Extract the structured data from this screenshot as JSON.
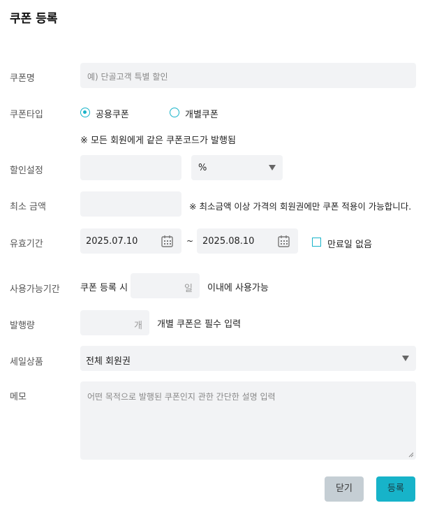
{
  "title": "쿠폰 등록",
  "labels": {
    "name": "쿠폰명",
    "type": "쿠폰타입",
    "discount": "할인설정",
    "min_amount": "최소 금액",
    "validity": "유효기간",
    "usable": "사용가능기간",
    "issue_qty": "발행량",
    "sale_item": "세일상품",
    "memo": "메모"
  },
  "coupon_name": {
    "placeholder": "예) 단골고객 특별 할인",
    "value": ""
  },
  "coupon_type": {
    "options": [
      "공용쿠폰",
      "개별쿠폰"
    ],
    "selected": "공용쿠폰",
    "note": "※ 모든 회원에게 같은 쿠폰코드가 발행됨"
  },
  "discount": {
    "value": "",
    "unit": "%"
  },
  "min_amount": {
    "value": "",
    "note": "※ 최소금액 이상 가격의 회원권에만 쿠폰 적용이 가능합니다."
  },
  "validity": {
    "start": "2025.07.10",
    "separator": "~",
    "end": "2025.08.10",
    "no_expiry_label": "만료일 없음",
    "no_expiry_checked": false
  },
  "usable": {
    "prefix": "쿠폰 등록 시",
    "unit": "일",
    "suffix": "이내에 사용가능"
  },
  "issue_qty": {
    "unit": "개",
    "note": "개별 쿠폰은 필수 입력"
  },
  "sale_item": {
    "value": "전체 회원권"
  },
  "memo": {
    "placeholder": "어떤 목적으로 발행된 쿠폰인지 관한 간단한 설명 입력"
  },
  "buttons": {
    "close": "닫기",
    "register": "등록"
  },
  "colors": {
    "accent": "#17b3c9",
    "field_bg": "#f2f3f5",
    "close_btn": "#c5ced4"
  }
}
